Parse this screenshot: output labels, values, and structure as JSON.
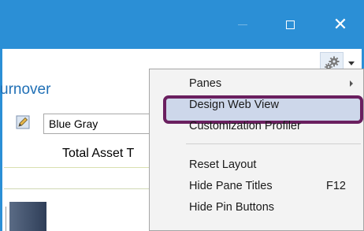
{
  "window": {
    "title_buttons": {
      "minimize": "minimize-icon",
      "maximize": "maximize-icon",
      "close": "close-icon"
    },
    "accent_color": "#2b8fd6"
  },
  "toolbar": {
    "gear_icon": "gear-icon",
    "dropdown_icon": "chevron-down-icon"
  },
  "content": {
    "heading": "urnover",
    "theme_value": "Blue Gray",
    "column_header": "Total Asset T"
  },
  "context_menu": {
    "items": [
      {
        "label": "Panes",
        "submenu": true
      },
      {
        "label": "Design Web View",
        "highlighted": true
      },
      {
        "label": "Customization Profiler"
      },
      {
        "label": "Reset Layout"
      },
      {
        "label": "Hide Pane Titles",
        "shortcut": "F12"
      },
      {
        "label": "Hide Pin Buttons"
      }
    ],
    "highlight_color": "#6a1f5f"
  }
}
